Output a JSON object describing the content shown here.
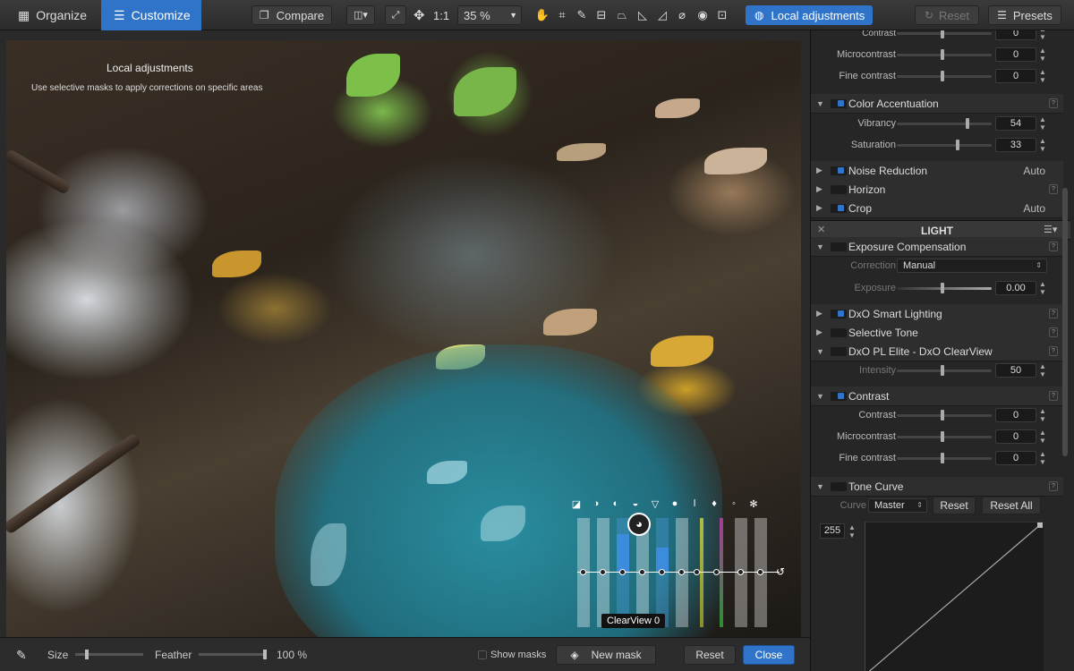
{
  "toolbar": {
    "organize": "Organize",
    "customize": "Customize",
    "compare": "Compare",
    "one_to_one": "1:1",
    "zoom": "35 %",
    "local_adjustments": "Local adjustments",
    "reset": "Reset",
    "presets": "Presets"
  },
  "overlay": {
    "title": "Local adjustments",
    "subtitle": "Use selective masks to apply corrections on specific areas"
  },
  "equalizer": {
    "label": "ClearView 0",
    "fill_levels": [
      0,
      0,
      0.7,
      0,
      0.45,
      0,
      0,
      0,
      0,
      0
    ]
  },
  "bottom": {
    "size_label": "Size",
    "feather_label": "Feather",
    "feather_value": "100 %",
    "show_masks": "Show masks",
    "new_mask": "New mask",
    "reset": "Reset",
    "close": "Close"
  },
  "panel": {
    "top_rows": [
      {
        "label": "Contrast",
        "value": "0"
      },
      {
        "label": "Microcontrast",
        "value": "0"
      },
      {
        "label": "Fine contrast",
        "value": "0"
      }
    ],
    "color_accentuation": {
      "title": "Color Accentuation",
      "vibrancy_label": "Vibrancy",
      "vibrancy": "54",
      "saturation_label": "Saturation",
      "saturation": "33"
    },
    "noise_reduction": {
      "title": "Noise Reduction",
      "right": "Auto"
    },
    "horizon": {
      "title": "Horizon"
    },
    "crop": {
      "title": "Crop",
      "right": "Auto"
    },
    "light_header": "LIGHT",
    "exposure": {
      "title": "Exposure Compensation",
      "correction_label": "Correction",
      "correction_value": "Manual",
      "exposure_label": "Exposure",
      "exposure_value": "0.00"
    },
    "smart_lighting": {
      "title": "DxO Smart Lighting"
    },
    "selective_tone": {
      "title": "Selective Tone"
    },
    "clearview": {
      "title": "DxO PL Elite - DxO ClearView",
      "intensity_label": "Intensity",
      "intensity": "50"
    },
    "contrast": {
      "title": "Contrast",
      "rows": [
        {
          "label": "Contrast",
          "value": "0"
        },
        {
          "label": "Microcontrast",
          "value": "0"
        },
        {
          "label": "Fine contrast",
          "value": "0"
        }
      ]
    },
    "tone_curve": {
      "title": "Tone Curve",
      "curve_label": "Curve",
      "curve_value": "Master",
      "reset": "Reset",
      "reset_all": "Reset All",
      "value_255": "255"
    }
  }
}
